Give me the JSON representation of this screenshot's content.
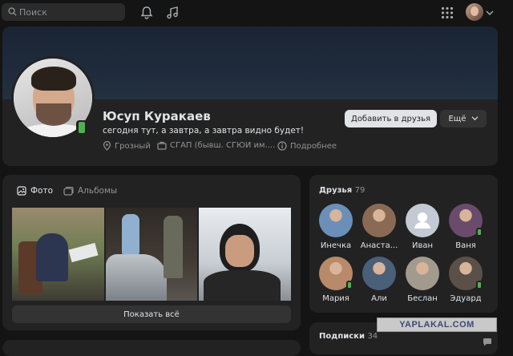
{
  "header": {
    "search_placeholder": "Поиск",
    "icons": [
      "search-icon",
      "bell-icon",
      "music-icon",
      "apps-grid-icon",
      "chevron-down-icon"
    ]
  },
  "profile": {
    "name": "Юсуп Куракаев",
    "status": "сегодня тут, а завтра, а завтра видно будет!",
    "city": "Грозный",
    "education": "СГАП (бывш. СГЮИ им....",
    "details_label": "Подробнее",
    "add_friend_label": "Добавить в друзья",
    "more_label": "Ещё"
  },
  "photos": {
    "tabs": [
      {
        "label": "Фото",
        "active": true
      },
      {
        "label": "Альбомы",
        "active": false
      }
    ],
    "show_all_label": "Показать всё"
  },
  "friends": {
    "title": "Друзья",
    "count": "79",
    "items": [
      {
        "name": "Инечка",
        "online": false,
        "color": "#6b8fb8"
      },
      {
        "name": "Анаста...",
        "online": false,
        "color": "#8a6a55"
      },
      {
        "name": "Иван",
        "online": false,
        "color": "#c4cad3",
        "placeholder": true
      },
      {
        "name": "Ваня",
        "online": true,
        "color": "#6a4b6b"
      },
      {
        "name": "Мария",
        "online": true,
        "color": "#b88a6a"
      },
      {
        "name": "Али",
        "online": false,
        "color": "#4a5f78"
      },
      {
        "name": "Беслан",
        "online": false,
        "color": "#a39a8e"
      },
      {
        "name": "Эдуард",
        "online": true,
        "color": "#5a5048"
      }
    ]
  },
  "subscriptions": {
    "title": "Подписки",
    "count": "34"
  },
  "watermark": "YAPLAKAL.COM",
  "colors": {
    "background": "#141414",
    "card": "#222222",
    "online": "#4bb34b",
    "primary_button": "#e1e3e6"
  }
}
